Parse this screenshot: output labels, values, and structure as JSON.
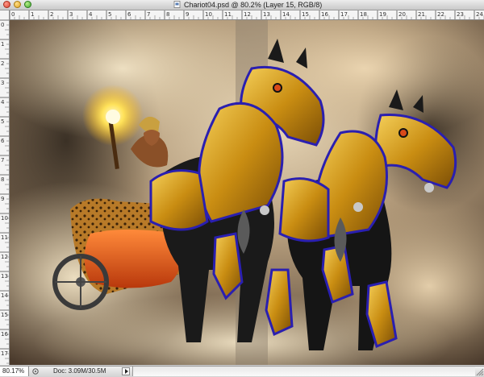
{
  "window": {
    "title": "Chariot04.psd @ 80.2% (Layer 15, RGB/8)",
    "file_icon": "psd-file-icon"
  },
  "ruler": {
    "horizontal_labels": [
      "0",
      "1",
      "2",
      "3",
      "4",
      "5",
      "6",
      "7",
      "8",
      "9",
      "10",
      "11",
      "12",
      "13",
      "14",
      "15",
      "16",
      "17",
      "18",
      "19",
      "20",
      "21",
      "22",
      "23",
      "24"
    ],
    "vertical_labels": [
      "0",
      "1",
      "2",
      "3",
      "4",
      "5",
      "6",
      "7",
      "8",
      "9",
      "10",
      "11",
      "12",
      "13",
      "14",
      "15",
      "16",
      "17"
    ]
  },
  "status": {
    "zoom": "80.17%",
    "doc_size": "Doc: 3.09M/30.5M",
    "icon": "document-status-icon"
  },
  "colors": {
    "armor_gold": "#d9a21e",
    "armor_trim": "#2a1fb0",
    "smoke": "#c9b89a",
    "chariot_orange": "#e0551a"
  }
}
